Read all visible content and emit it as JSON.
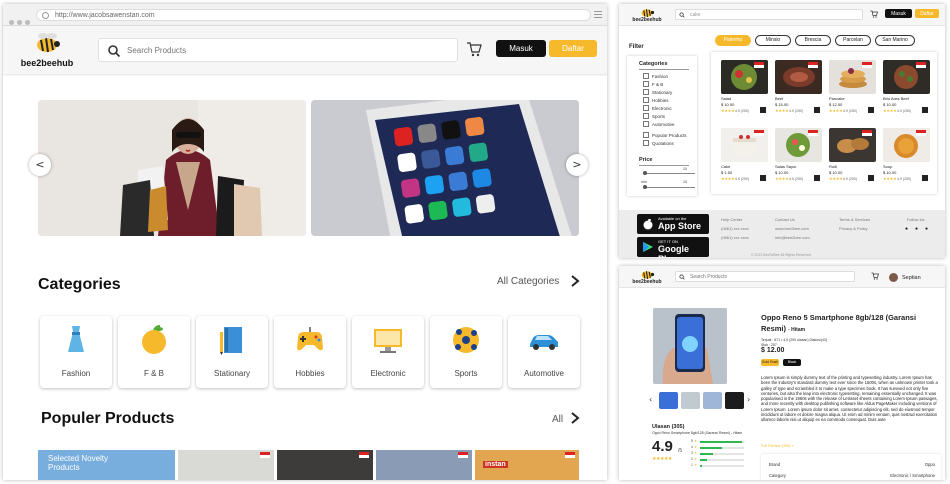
{
  "main": {
    "url": "http://www.jacobsawenstan.com",
    "logo_text": "bee2beehub",
    "search_placeholder": "Search Products",
    "masuk": "Masuk",
    "daftar": "Daftar",
    "prev_arrow": "<",
    "next_arrow": ">",
    "categories_title": "Categories",
    "all_categories": "All Categories",
    "categories": [
      {
        "label": "Fashion",
        "icon": "dress-icon"
      },
      {
        "label": "F & B",
        "icon": "apple-icon"
      },
      {
        "label": "Stationary",
        "icon": "notebook-icon"
      },
      {
        "label": "Hobbies",
        "icon": "gamepad-icon"
      },
      {
        "label": "Electronic",
        "icon": "monitor-icon"
      },
      {
        "label": "Sports",
        "icon": "ball-icon"
      },
      {
        "label": "Automotive",
        "icon": "car-icon"
      }
    ],
    "popular_title": "Populer Products",
    "all_link": "All",
    "novelty_label": "Selected Novelty Products",
    "instan_label": "instan"
  },
  "listing": {
    "logo_text": "bee2beehub",
    "search_value": "cake",
    "masuk": "Masuk",
    "daftar": "Daftar",
    "cities": [
      {
        "label": "Palermo",
        "active": true
      },
      {
        "label": "Minsio",
        "active": false
      },
      {
        "label": "Brescia",
        "active": false
      },
      {
        "label": "Parcelan",
        "active": false
      },
      {
        "label": "San Marino",
        "active": false
      }
    ],
    "filter_title": "Filter",
    "categories_title": "Categories",
    "categories": [
      "Fashion",
      "F & B",
      "Stationary",
      "Hobbies",
      "Electronic",
      "Sports",
      "Automotive"
    ],
    "extra_filters": [
      "Popular Products",
      "Quotations"
    ],
    "price_title": "Price",
    "price_min_label": "min",
    "price_max_label": "max",
    "price_min": "10",
    "price_max": "10",
    "products": [
      {
        "name": "Salad",
        "price": "$ 10.00",
        "stars": "★★★★",
        "extra": "4.9 (250)"
      },
      {
        "name": "Beef",
        "price": "$ 15.00",
        "stars": "★★★★",
        "extra": "4.9 (250)"
      },
      {
        "name": "Pancake",
        "price": "$ 12.00",
        "stars": "★★★★",
        "extra": "4.9 (250)"
      },
      {
        "name": "Brio Area Beef",
        "price": "$ 10.00",
        "stars": "★★★★",
        "extra": "4.9 (250)"
      },
      {
        "name": "Cake",
        "price": "$ 1.50",
        "stars": "★★★★",
        "extra": "4.9 (250)"
      },
      {
        "name": "Salas Sayur",
        "price": "$ 10.00",
        "stars": "★★★★",
        "extra": "4.9 (250)"
      },
      {
        "name": "Rolti",
        "price": "$ 10.00",
        "stars": "★★★★",
        "extra": "4.9 (250)"
      },
      {
        "name": "Soup",
        "price": "$ 10.00",
        "stars": "★★★★",
        "extra": "4.9 (250)"
      }
    ],
    "appstore_small": "Available on the",
    "appstore_big": "App Store",
    "googleplay_small": "GET IT ON",
    "googleplay_big": "Google Play",
    "footer": {
      "help_title": "Help Center",
      "help_lines": [
        "(0861) xxx xxxx",
        "(0861) xxx xxxx"
      ],
      "contact_title": "Contact Us",
      "contact_lines": [
        "www.bee2bee.com",
        "info@bee2bee.com"
      ],
      "terms_title": "Terms & Services",
      "terms_lines": [
        "Privacy & Policy"
      ],
      "follow_title": "Follow Us",
      "copyright": "© 2021 BeeToBee All Rights Reserved"
    }
  },
  "detail": {
    "logo_text": "bee2beehub",
    "search_placeholder": "Search Products",
    "user_name": "Septian",
    "product_title": "Oppo Reno 5 Smartphone 8gb/128 (Garansi Resmi)",
    "color": "- Hitam",
    "meta_line": "Terjual : 671  •  4.9 (290 ulasan)  Diskusi(43)",
    "stock_line": "Stok : 257",
    "price": "$ 12.00",
    "color_options": [
      "Gold Rush",
      "Black"
    ],
    "description": "Lorem Ipsum is simply dummy text of the printing and typesetting industry. Lorem Ipsum has been the industry's standard dummy text ever since the 1500s, when an unknown printer took a galley of type and scrambled it to make a type specimen book. It has survived not only five centuries, but also the leap into electronic typesetting, remaining essentially unchanged. It was popularised in the 1960s with the release of Letraset sheets containing Lorem Ipsum passages, and more recently with desktop publishing software like Aldus PageMaker including versions of Lorem Ipsum. Lorem ipsum dolor sit amet, consectetur adipiscing elit, sed do eiusmod tempor incididunt ut labore et dolore magna aliqua. Ut enim ad minim veniam, quis nostrud exercitation ullamco laboris nisi ut aliquip ex ea commodo consequat. Duis aute",
    "ulasan_title": "Ulasan (305)",
    "ulasan_sub": "Oppo Reno Smartphone 8gb/128 (Garansi Resmi) - Hitam",
    "score": "4.9",
    "score_max": "/5",
    "stars": "★★★★★",
    "rating_bars": [
      {
        "n": "5",
        "fill": 0.95
      },
      {
        "n": "4",
        "fill": 0.5
      },
      {
        "n": "3",
        "fill": 0.3
      },
      {
        "n": "2",
        "fill": 0.15
      },
      {
        "n": "1",
        "fill": 0.05
      }
    ],
    "full_review": "Full Review (305)  »",
    "specs": [
      {
        "key": "Brand",
        "value": "Oppo"
      },
      {
        "key": "Category",
        "value": "Electronic / Smartphone"
      }
    ]
  }
}
